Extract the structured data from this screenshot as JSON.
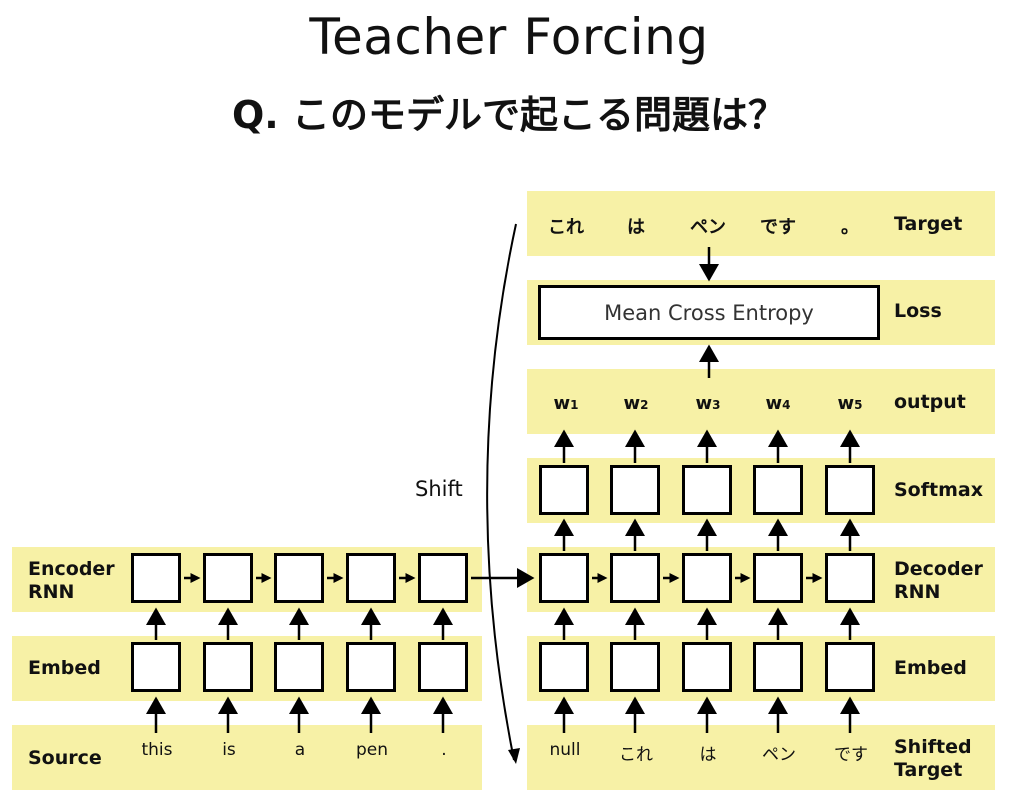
{
  "title": "Teacher Forcing",
  "subtitle": "Q. このモデルで起こる問題は？",
  "loss_box": "Mean Cross Entropy",
  "shift_label": "Shift",
  "labels": {
    "target": "Target",
    "loss": "Loss",
    "output": "output",
    "softmax": "Softmax",
    "decoder_line1": "Decoder",
    "decoder_line2": "RNN",
    "embed_right": "Embed",
    "shifted_line1": "Shifted",
    "shifted_line2": "Target",
    "encoder_line1": "Encoder",
    "encoder_line2": "RNN",
    "embed_left": "Embed",
    "source": "Source"
  },
  "target_tokens": [
    "これ",
    "は",
    "ペン",
    "です",
    "。"
  ],
  "outputs": [
    {
      "w": "w",
      "sub": "1"
    },
    {
      "w": "w",
      "sub": "2"
    },
    {
      "w": "w",
      "sub": "3"
    },
    {
      "w": "w",
      "sub": "4"
    },
    {
      "w": "w",
      "sub": "5"
    }
  ],
  "source_tokens": [
    "this",
    "is",
    "a",
    "pen",
    "."
  ],
  "shifted_tokens": [
    "null",
    "これ",
    "は",
    "ペン",
    "です"
  ],
  "colors": {
    "band": "#f7f1a6",
    "box_border": "#000000"
  }
}
